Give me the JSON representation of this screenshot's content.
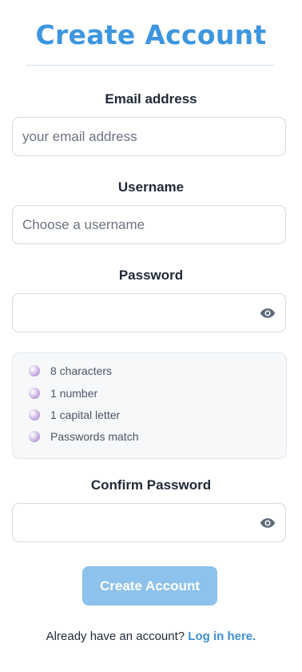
{
  "page": {
    "title": "Create Account"
  },
  "form": {
    "email": {
      "label": "Email address",
      "placeholder": "your email address",
      "value": ""
    },
    "username": {
      "label": "Username",
      "placeholder": "Choose a username",
      "value": ""
    },
    "password": {
      "label": "Password",
      "placeholder": "",
      "value": ""
    },
    "requirements": [
      {
        "label": "8 characters",
        "met": false
      },
      {
        "label": "1 number",
        "met": false
      },
      {
        "label": "1 capital letter",
        "met": false
      },
      {
        "label": "Passwords match",
        "met": false
      }
    ],
    "confirm_password": {
      "label": "Confirm Password",
      "placeholder": "",
      "value": ""
    },
    "submit_label": "Create Account"
  },
  "footer": {
    "prompt": "Already have an account?",
    "link_label": "Log in here."
  },
  "icons": {
    "password_toggle": "eye-icon",
    "requirement_status": "bullet-icon"
  },
  "colors": {
    "accent": "#3d96e0",
    "button_disabled": "#8cc2ec",
    "link": "#3d8fd6"
  }
}
